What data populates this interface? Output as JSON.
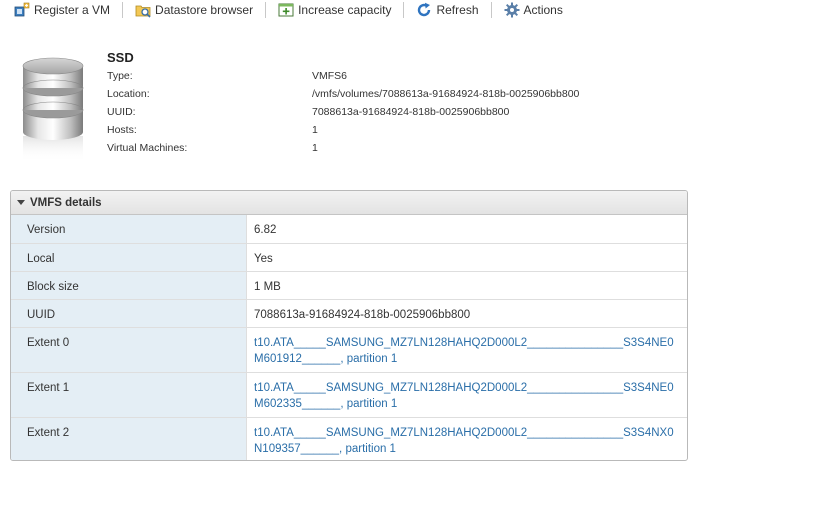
{
  "toolbar": {
    "register_vm": "Register a VM",
    "datastore_browser": "Datastore browser",
    "increase_capacity": "Increase capacity",
    "refresh": "Refresh",
    "actions": "Actions"
  },
  "summary": {
    "title": "SSD",
    "rows": [
      {
        "label": "Type:",
        "value": "VMFS6"
      },
      {
        "label": "Location:",
        "value": "/vmfs/volumes/7088613a-91684924-818b-0025906bb800"
      },
      {
        "label": "UUID:",
        "value": "7088613a-91684924-818b-0025906bb800"
      },
      {
        "label": "Hosts:",
        "value": "1"
      },
      {
        "label": "Virtual Machines:",
        "value": "1"
      }
    ]
  },
  "vmfs_details": {
    "header": "VMFS details",
    "rows": [
      {
        "key": "Version",
        "value": "6.82"
      },
      {
        "key": "Local",
        "value": "Yes"
      },
      {
        "key": "Block size",
        "value": "1 MB"
      },
      {
        "key": "UUID",
        "value": "7088613a-91684924-818b-0025906bb800"
      }
    ],
    "extents": [
      {
        "key": "Extent 0",
        "line1": "t10.ATA_____SAMSUNG_MZ7LN128HAHQ2D000L2_______________S3S4NE0",
        "line2": "M601912______, partition 1"
      },
      {
        "key": "Extent 1",
        "line1": "t10.ATA_____SAMSUNG_MZ7LN128HAHQ2D000L2_______________S3S4NE0",
        "line2": "M602335______, partition 1"
      },
      {
        "key": "Extent 2",
        "line1": "t10.ATA_____SAMSUNG_MZ7LN128HAHQ2D000L2_______________S3S4NX0",
        "line2": "N109357______, partition 1"
      }
    ]
  },
  "colors": {
    "link": "#2a6ea8",
    "key_bg": "#e4eef5",
    "header_bg": "#e8e8e8"
  },
  "icons": [
    "register-vm-icon",
    "datastore-browser-icon",
    "increase-capacity-icon",
    "refresh-icon",
    "actions-gear-icon",
    "datastore-database-icon"
  ]
}
